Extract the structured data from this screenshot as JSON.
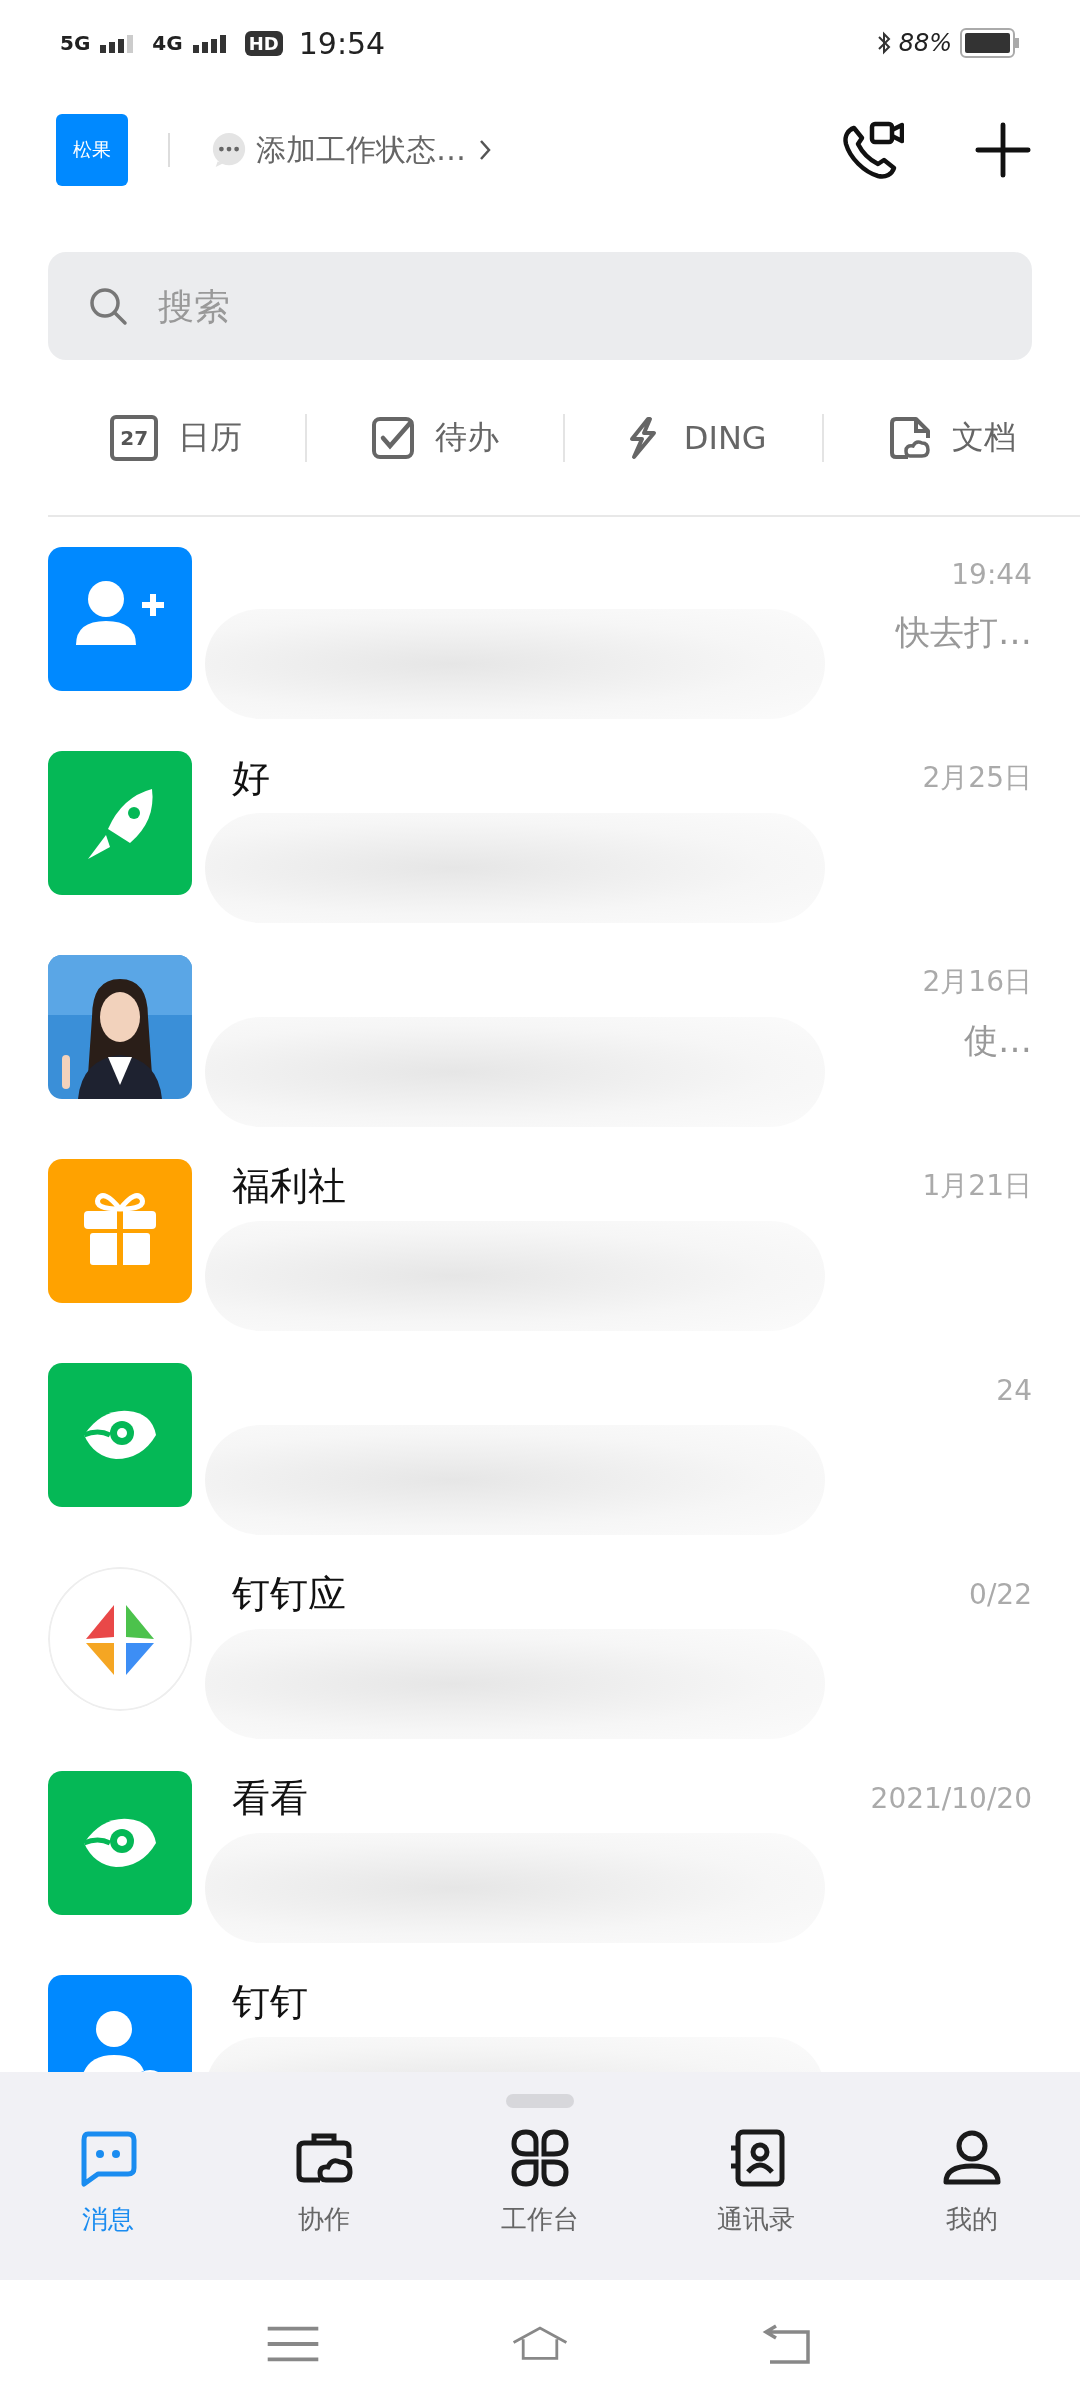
{
  "status_bar": {
    "network_1": "5G",
    "network_2": "4G",
    "hd": "HD",
    "time": "19:54",
    "battery": "88%"
  },
  "header": {
    "avatar": "松果",
    "work_status": "添加工作状态…"
  },
  "search": {
    "placeholder": "搜索"
  },
  "shortcuts": [
    {
      "kind": "calendar",
      "label": "日历",
      "day": "27"
    },
    {
      "kind": "todo",
      "label": "待办"
    },
    {
      "kind": "ding",
      "label": "DING"
    },
    {
      "kind": "doc",
      "label": "文档"
    }
  ],
  "conversations": [
    {
      "kind": "user-plus",
      "time": "19:44",
      "preview": "快去打…"
    },
    {
      "kind": "rocket",
      "title": "好",
      "time": "2月25日"
    },
    {
      "kind": "picture",
      "time": "2月16日",
      "preview": "使…"
    },
    {
      "kind": "gift",
      "title": "福利社",
      "time": "1月21日"
    },
    {
      "kind": "eye",
      "time": "24"
    },
    {
      "kind": "star",
      "title": "钉钉应",
      "time": "0/22"
    },
    {
      "kind": "eye",
      "title": "看看",
      "time": "2021/10/20"
    },
    {
      "kind": "user-gear",
      "title": "钉钉"
    }
  ],
  "tabs": [
    {
      "kind": "message",
      "label": "消息",
      "selected": true
    },
    {
      "kind": "collab",
      "label": "协作",
      "selected": false
    },
    {
      "kind": "workbench",
      "label": "工作台",
      "selected": false
    },
    {
      "kind": "contacts",
      "label": "通讯录",
      "selected": false
    },
    {
      "kind": "me",
      "label": "我的",
      "selected": false
    }
  ]
}
